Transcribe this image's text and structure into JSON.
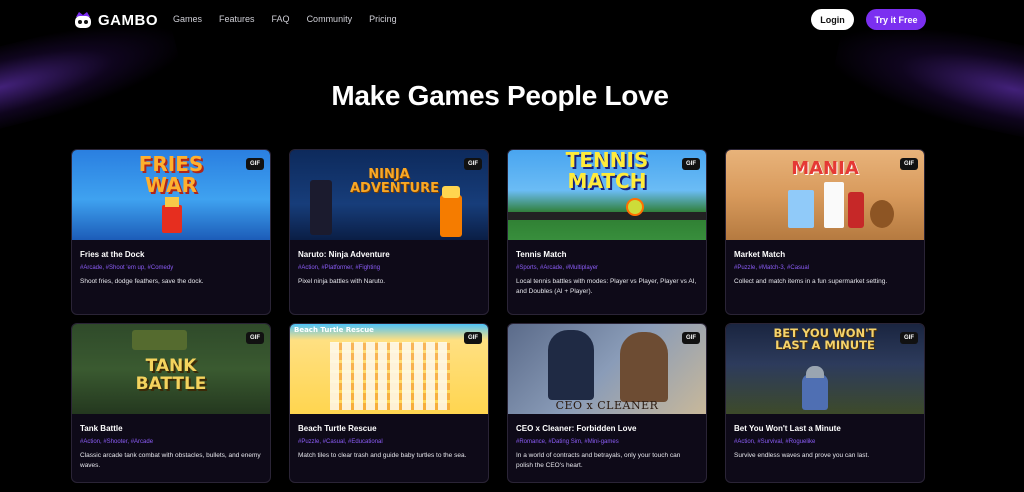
{
  "brand": {
    "name": "GAMBO"
  },
  "nav": {
    "links": [
      "Games",
      "Features",
      "FAQ",
      "Community",
      "Pricing"
    ],
    "login_label": "Login",
    "try_label": "Try it Free"
  },
  "hero": {
    "title": "Make Games People Love"
  },
  "colors": {
    "accent": "#7b2ff0",
    "tag": "#8b5cf6",
    "card_bg": "#0e0a18"
  },
  "cards": [
    {
      "title": "Fries at the Dock",
      "tags": "#Arcade, #Shoot 'em up, #Comedy",
      "desc": "Shoot fries, dodge feathers, save the dock.",
      "badge": "GIF",
      "art_text": "FRIES WAR"
    },
    {
      "title": "Naruto: Ninja Adventure",
      "tags": "#Action, #Platformer, #Fighting",
      "desc": "Pixel ninja battles with Naruto.",
      "badge": "GIF",
      "art_text": "NINJA ADVENTURE"
    },
    {
      "title": "Tennis Match",
      "tags": "#Sports, #Arcade, #Multiplayer",
      "desc": "Local tennis battles with modes: Player vs Player, Player vs AI, and Doubles (AI + Player).",
      "badge": "GIF",
      "art_text": "TENNIS MATCH"
    },
    {
      "title": "Market Match",
      "tags": "#Puzzle, #Match-3, #Casual",
      "desc": "Collect and match items in a fun supermarket setting.",
      "badge": "GIF",
      "art_text": "MANIA"
    },
    {
      "title": "Tank Battle",
      "tags": "#Action, #Shooter, #Arcade",
      "desc": "Classic arcade tank combat with obstacles, bullets, and enemy waves.",
      "badge": "GIF",
      "art_text": "TANK BATTLE"
    },
    {
      "title": "Beach Turtle Rescue",
      "tags": "#Puzzle, #Casual, #Educational",
      "desc": "Match tiles to clear trash and guide baby turtles to the sea.",
      "badge": "GIF",
      "art_text": "Beach Turtle Rescue"
    },
    {
      "title": "CEO x Cleaner: Forbidden Love",
      "tags": "#Romance, #Dating Sim, #Mini-games",
      "desc": "In a world of contracts and betrayals, only your touch can polish the CEO's heart.",
      "badge": "GIF",
      "art_text": "CEO x CLEANER"
    },
    {
      "title": "Bet You Won't Last a Minute",
      "tags": "#Action, #Survival, #Roguelike",
      "desc": "Survive endless waves and prove you can last.",
      "badge": "GIF",
      "art_text": "BET YOU WON'T LAST A MINUTE"
    }
  ]
}
